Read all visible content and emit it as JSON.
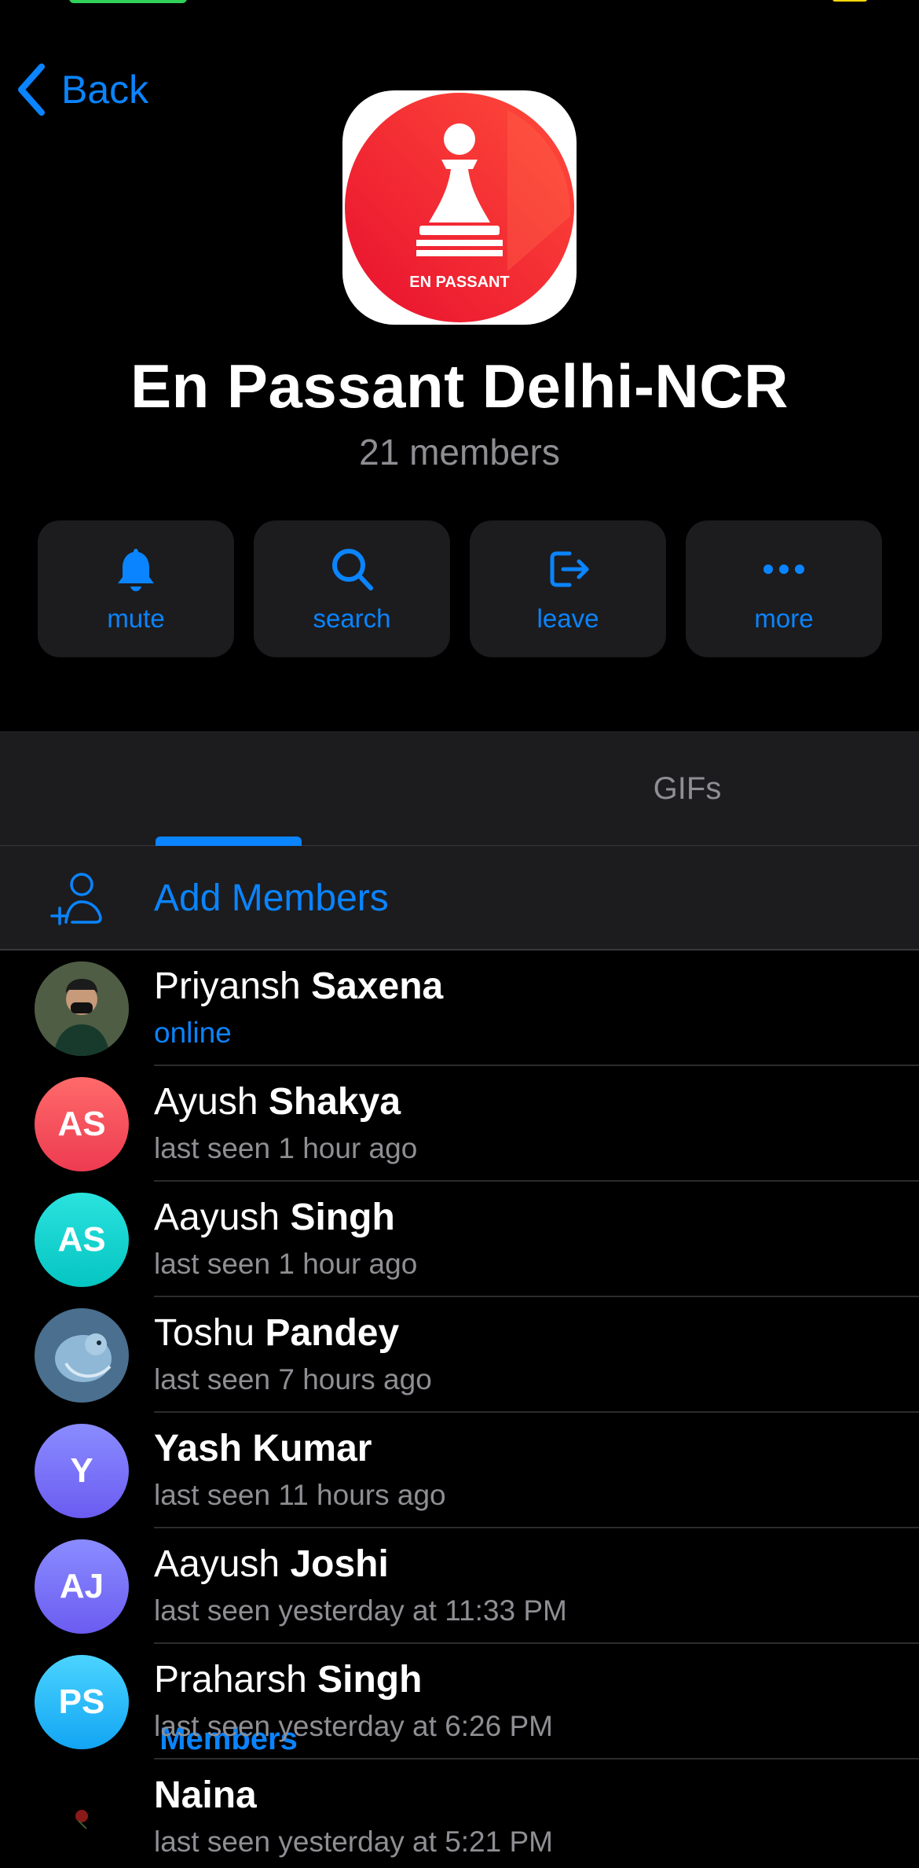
{
  "nav": {
    "back_label": "Back"
  },
  "group": {
    "title": "En Passant Delhi-NCR",
    "subtitle": "21 members",
    "logo_text": "EN PASSANT"
  },
  "actions": [
    {
      "label": "mute",
      "icon": "bell-icon"
    },
    {
      "label": "search",
      "icon": "search-icon"
    },
    {
      "label": "leave",
      "icon": "leave-icon"
    },
    {
      "label": "more",
      "icon": "more-icon"
    }
  ],
  "tabs": [
    {
      "label": "Members",
      "active": true
    },
    {
      "label": "GIFs",
      "active": false
    }
  ],
  "add_members_label": "Add Members",
  "colors": {
    "accent": "#0a84ff",
    "background": "#000000",
    "surface": "#1c1c1e",
    "secondary_text": "#8e8e93"
  },
  "members": [
    {
      "first": "Priyansh",
      "last": "Saxena",
      "status": "online",
      "initials": ""
    },
    {
      "first": "Ayush",
      "last": "Shakya",
      "status": "last seen 1 hour ago",
      "initials": "AS"
    },
    {
      "first": "Aayush",
      "last": "Singh",
      "status": "last seen 1 hour ago",
      "initials": "AS"
    },
    {
      "first": "Toshu",
      "last": "Pandey",
      "status": "last seen 7 hours ago",
      "initials": ""
    },
    {
      "first": "",
      "last": "Yash Kumar",
      "status": "last seen 11 hours ago",
      "initials": "Y"
    },
    {
      "first": "Aayush",
      "last": "Joshi",
      "status": "last seen yesterday at 11:33 PM",
      "initials": "AJ"
    },
    {
      "first": "Praharsh",
      "last": "Singh",
      "status": "last seen yesterday at 6:26 PM",
      "initials": "PS"
    },
    {
      "first": "",
      "last": "Naina",
      "status": "last seen yesterday at 5:21 PM",
      "initials": ""
    }
  ]
}
